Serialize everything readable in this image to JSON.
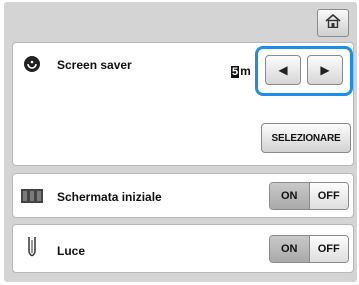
{
  "top_bar": {
    "home_icon": "home-icon"
  },
  "screen_saver": {
    "label": "Screen saver",
    "icon": "screen-saver-icon",
    "minutes_digit": "5",
    "minutes_unit": "mi",
    "left_arrow": "◀",
    "right_arrow": "▶",
    "select_label": "SELEZIONARE",
    "highlight_color": "#1e8fe8"
  },
  "startup_screen": {
    "label": "Schermata iniziale",
    "icon": "startup-screen-icon",
    "on_label": "ON",
    "off_label": "OFF",
    "selected": "ON"
  },
  "light": {
    "label": "Luce",
    "icon": "needle-light-icon",
    "on_label": "ON",
    "off_label": "OFF",
    "selected": "ON"
  }
}
